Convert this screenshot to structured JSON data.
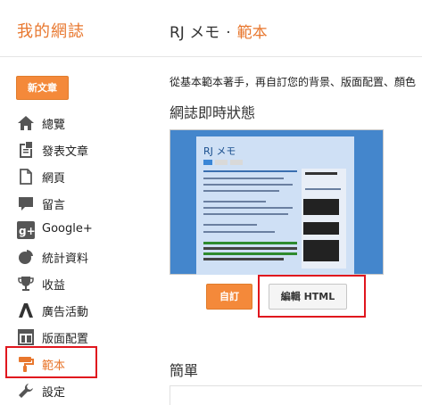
{
  "header": {
    "app_title": "我的網誌",
    "blog_name": "RJ メモ",
    "separator": "·",
    "current_page": "範本"
  },
  "sidebar": {
    "new_post_label": "新文章",
    "items": [
      {
        "label": "總覽",
        "icon": "home-icon"
      },
      {
        "label": "發表文章",
        "icon": "posts-icon"
      },
      {
        "label": "網頁",
        "icon": "page-icon"
      },
      {
        "label": "留言",
        "icon": "comment-icon"
      },
      {
        "label": "Google+",
        "icon": "google-plus-icon"
      },
      {
        "label": "統計資料",
        "icon": "stats-icon"
      },
      {
        "label": "收益",
        "icon": "trophy-icon"
      },
      {
        "label": "廣告活動",
        "icon": "campaign-icon"
      },
      {
        "label": "版面配置",
        "icon": "layout-icon"
      },
      {
        "label": "範本",
        "icon": "template-icon",
        "active": true
      },
      {
        "label": "設定",
        "icon": "wrench-icon"
      }
    ]
  },
  "main": {
    "intro": "從基本範本著手，再自訂您的背景、版面配置、顏色",
    "live_section_title": "網誌即時狀態",
    "preview_blog_title": "RJ メモ",
    "customize_label": "自訂",
    "edit_html_label": "編輯 HTML",
    "mobile_section_title": "簡單"
  },
  "colors": {
    "accent": "#e8772e",
    "button_orange": "#f4893a",
    "highlight_red": "#e0161e",
    "preview_blue": "#4486cc"
  }
}
